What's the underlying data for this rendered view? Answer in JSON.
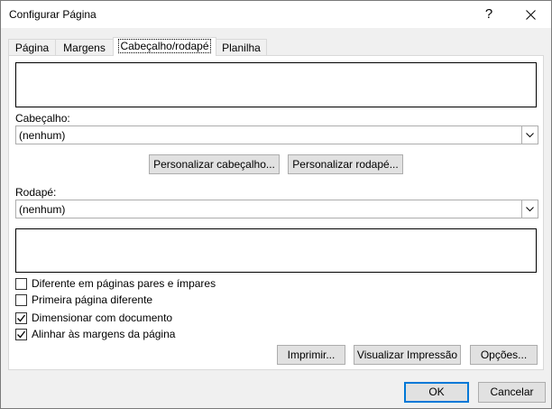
{
  "window": {
    "title": "Configurar Página",
    "help_glyph": "?",
    "close_glyph": "✕"
  },
  "tabs": [
    {
      "label": "Página"
    },
    {
      "label": "Margens"
    },
    {
      "label": "Cabeçalho/rodapé",
      "active": true
    },
    {
      "label": "Planilha"
    }
  ],
  "header": {
    "label": "Cabeçalho:",
    "value": "(nenhum)",
    "customize_button": "Personalizar cabeçalho..."
  },
  "footer": {
    "label": "Rodapé:",
    "value": "(nenhum)",
    "customize_button": "Personalizar rodapé..."
  },
  "options": [
    {
      "label": "Diferente em páginas pares e ímpares",
      "checked": false
    },
    {
      "label": "Primeira página diferente",
      "checked": false
    },
    {
      "label": "Dimensionar com documento",
      "checked": true
    },
    {
      "label": "Alinhar às margens da página",
      "checked": true
    }
  ],
  "actions": {
    "print": "Imprimir...",
    "preview": "Visualizar Impressão",
    "options": "Opções..."
  },
  "footer_buttons": {
    "ok": "OK",
    "cancel": "Cancelar"
  },
  "colors": {
    "accent": "#0078d7"
  }
}
